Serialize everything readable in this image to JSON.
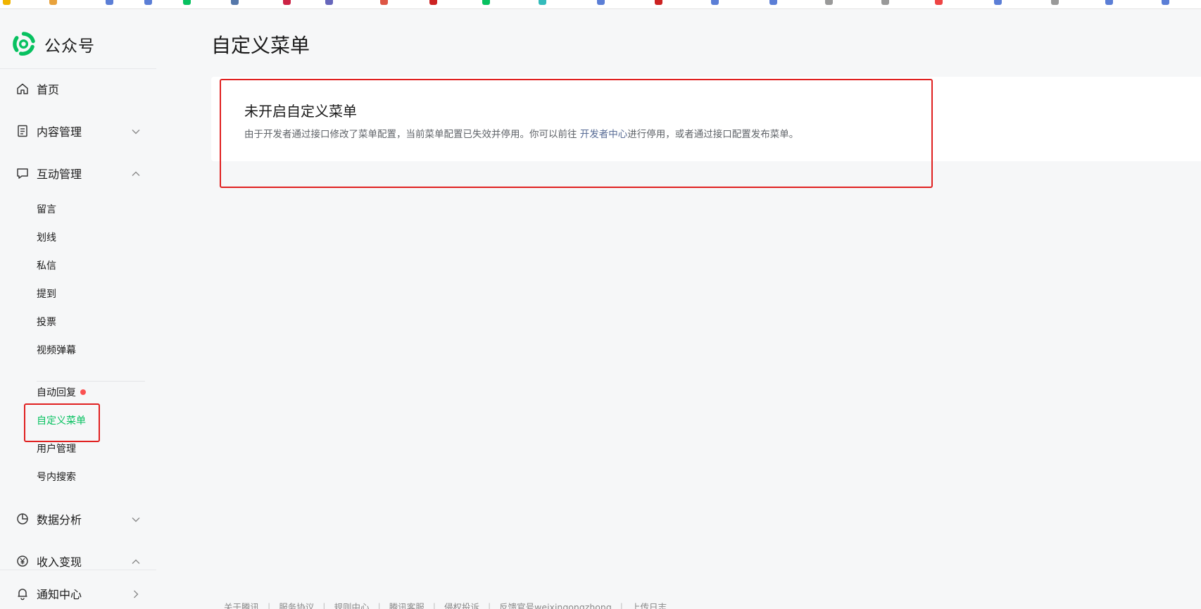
{
  "brand": {
    "name": "公众号",
    "accent": "#07c160"
  },
  "sidebar": {
    "home": {
      "label": "首页",
      "icon": "home-icon"
    },
    "content": {
      "label": "内容管理",
      "icon": "document-icon",
      "expanded": false
    },
    "interaction": {
      "label": "互动管理",
      "icon": "chat-icon",
      "expanded": true,
      "items": [
        {
          "label": "留言"
        },
        {
          "label": "划线"
        },
        {
          "label": "私信"
        },
        {
          "label": "提到"
        },
        {
          "label": "投票"
        },
        {
          "label": "视频弹幕"
        }
      ],
      "items2": [
        {
          "label": "自动回复",
          "badge": true
        },
        {
          "label": "自定义菜单",
          "active": true
        },
        {
          "label": "用户管理"
        },
        {
          "label": "号内搜索"
        }
      ]
    },
    "analytics": {
      "label": "数据分析",
      "icon": "pie-chart-icon",
      "expanded": false
    },
    "monetize": {
      "label": "收入变现",
      "icon": "yen-icon",
      "expanded": true
    },
    "notifications": {
      "label": "通知中心",
      "icon": "bell-icon"
    }
  },
  "main": {
    "title": "自定义菜单",
    "card": {
      "title": "未开启自定义菜单",
      "desc_before": "由于开发者通过接口修改了菜单配置，当前菜单配置已失效并停用。你可以前往 ",
      "desc_link": "开发者中心",
      "desc_after": "进行停用，或者通过接口配置发布菜单。"
    }
  },
  "footer": {
    "links": [
      "关于腾讯",
      "服务协议",
      "规则中心",
      "腾讯客服",
      "侵权投诉",
      "反馈官号weixingongzhong",
      "上传日志"
    ]
  }
}
